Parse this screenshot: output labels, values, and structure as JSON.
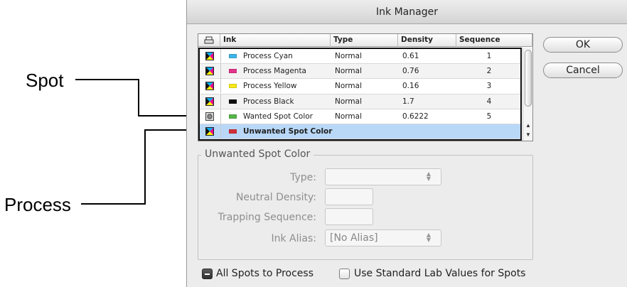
{
  "callouts": {
    "spot": "Spot",
    "process": "Process"
  },
  "dialog": {
    "title": "Ink Manager"
  },
  "table": {
    "columns": [
      "Ink",
      "Type",
      "Density",
      "Sequence"
    ],
    "rows": [
      {
        "icon": "process-icon",
        "swatch": "#3db5e8",
        "name": "Process Cyan",
        "type": "Normal",
        "density": "0.61",
        "sequence": "1"
      },
      {
        "icon": "process-icon",
        "swatch": "#e2348b",
        "name": "Process Magenta",
        "type": "Normal",
        "density": "0.76",
        "sequence": "2"
      },
      {
        "icon": "process-icon",
        "swatch": "#f7e91a",
        "name": "Process Yellow",
        "type": "Normal",
        "density": "0.16",
        "sequence": "3"
      },
      {
        "icon": "process-icon",
        "swatch": "#111111",
        "name": "Process Black",
        "type": "Normal",
        "density": "1.7",
        "sequence": "4"
      },
      {
        "icon": "spot-icon",
        "swatch": "#55b64a",
        "name": "Wanted Spot Color",
        "type": "Normal",
        "density": "0.6222",
        "sequence": "5"
      },
      {
        "icon": "process-icon",
        "swatch": "#d32f3a",
        "name": "Unwanted Spot Color",
        "type": "",
        "density": "",
        "sequence": ""
      }
    ]
  },
  "buttons": {
    "ok": "OK",
    "cancel": "Cancel"
  },
  "details": {
    "title": "Unwanted Spot Color",
    "type_label": "Type:",
    "type_value": "",
    "neutral_density_label": "Neutral Density:",
    "neutral_density_value": "",
    "trapping_sequence_label": "Trapping Sequence:",
    "trapping_sequence_value": "",
    "ink_alias_label": "Ink Alias:",
    "ink_alias_value": "[No Alias]"
  },
  "options": {
    "all_spots_to_process": "All Spots to Process",
    "use_standard_lab": "Use Standard Lab Values for Spots"
  }
}
